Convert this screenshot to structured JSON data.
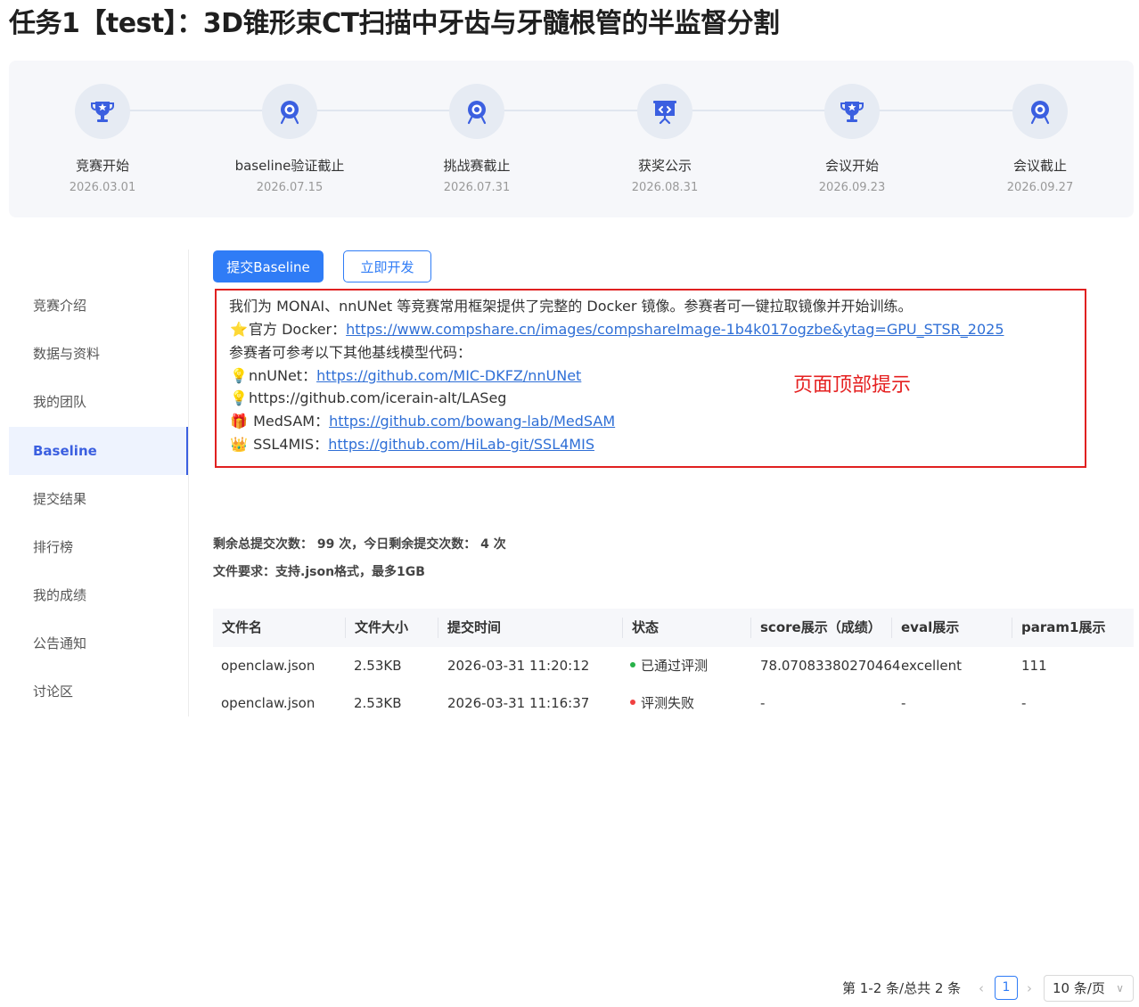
{
  "page": {
    "title": "任务1【test】：3D锥形束CT扫描中牙齿与牙髓根管的半监督分割"
  },
  "timeline": {
    "milestones": [
      {
        "label": "竞赛开始",
        "date": "2026.03.01",
        "icon": "trophy-icon"
      },
      {
        "label": "baseline验证截止",
        "date": "2026.07.15",
        "icon": "target-icon"
      },
      {
        "label": "挑战赛截止",
        "date": "2026.07.31",
        "icon": "target-icon"
      },
      {
        "label": "获奖公示",
        "date": "2026.08.31",
        "icon": "presentation-board-icon"
      },
      {
        "label": "会议开始",
        "date": "2026.09.23",
        "icon": "trophy-icon"
      },
      {
        "label": "会议截止",
        "date": "2026.09.27",
        "icon": "target-icon"
      }
    ],
    "colors": {
      "icon": "#3b5fe0",
      "circle": "#e6ebf3"
    }
  },
  "sidebar": {
    "items": [
      {
        "label": "竞赛介绍"
      },
      {
        "label": "数据与资料"
      },
      {
        "label": "我的团队"
      },
      {
        "label": "Baseline",
        "active": true
      },
      {
        "label": "提交结果"
      },
      {
        "label": "排行榜"
      },
      {
        "label": "我的成绩"
      },
      {
        "label": "公告通知"
      },
      {
        "label": "讨论区"
      }
    ]
  },
  "actions": {
    "submit_label": "提交Baseline",
    "develop_label": "立即开发"
  },
  "notice": {
    "intro": "我们为 MONAI、nnUNet 等竞赛常用框架提供了完整的 Docker 镜像。参赛者可一键拉取镜像并开始训练。",
    "docker_prefix": "官方 Docker：",
    "docker_link": "https://www.compshare.cn/images/compshareImage-1b4k017ogzbe&ytag=GPU_STSR_2025",
    "refs_heading": "参赛者可参考以下其他基线模型代码：",
    "nnunet_prefix": "nnUNet：",
    "nnunet_link": "https://github.com/MIC-DKFZ/nnUNet",
    "laseg_text": "https://github.com/icerain-alt/LASeg",
    "medsam_prefix": "MedSAM：",
    "medsam_link": "https://github.com/bowang-lab/MedSAM",
    "ssl_prefix": "SSL4MIS：",
    "ssl_link": "https://github.com/HiLab-git/SSL4MIS",
    "annotation": "页面顶部提示",
    "emojis": {
      "star": "⭐",
      "bulb": "💡",
      "gift": "🎁",
      "crown": "👑"
    },
    "colors": {
      "border": "#e02020",
      "annotation": "#e52020",
      "link": "#2f6fd6"
    }
  },
  "submission_info": {
    "quota_text": "剩余总提交次数： 99 次，今日剩余提交次数：  4  次",
    "file_req_text": "文件要求：支持.json格式，最多1GB"
  },
  "table": {
    "columns": [
      "文件名",
      "文件大小",
      "提交时间",
      "状态",
      "score展示（成绩）",
      "eval展示",
      "param1展示"
    ],
    "rows": [
      {
        "filename": "openclaw.json",
        "size": "2.53KB",
        "time": "2026-03-31 11:20:12",
        "status": "已通过评测",
        "status_color": "#27b148",
        "score": "78.07083380270464",
        "eval": "excellent",
        "param1": "111"
      },
      {
        "filename": "openclaw.json",
        "size": "2.53KB",
        "time": "2026-03-31 11:16:37",
        "status": "评测失败",
        "status_color": "#f04040",
        "score": "-",
        "eval": "-",
        "param1": "-"
      }
    ]
  },
  "pagination": {
    "total_text": "第 1-2 条/总共 2 条",
    "current_page": "1",
    "page_size": "10 条/页",
    "prev": "‹",
    "next": "›",
    "chevron": "∨"
  },
  "colors": {
    "primary": "#2f7cf6",
    "active_nav": "#3b5fe0",
    "active_nav_bg": "#eef3fe"
  }
}
